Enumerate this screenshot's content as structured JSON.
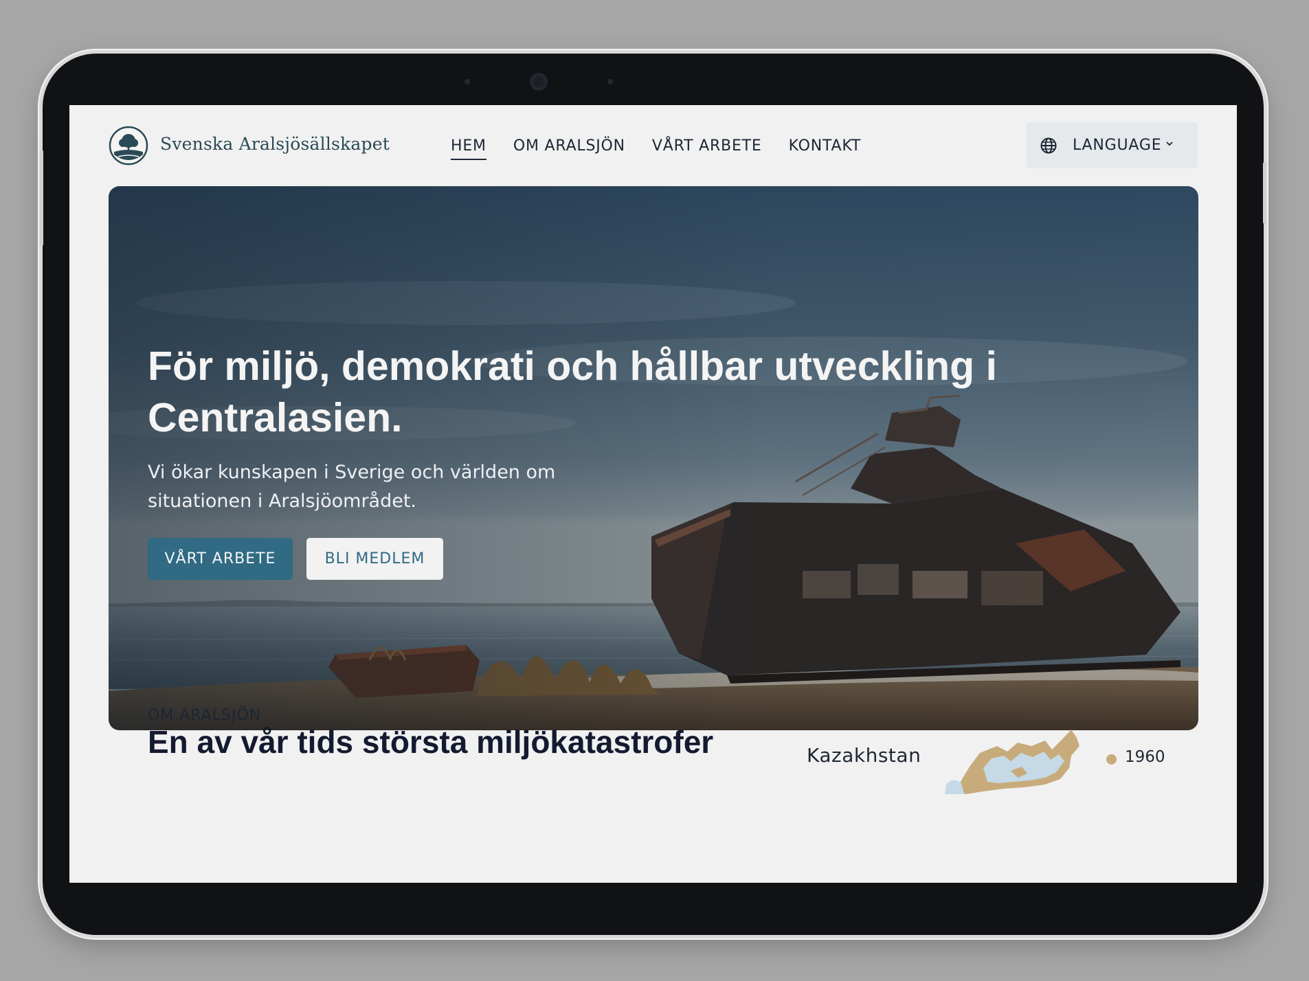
{
  "header": {
    "brand_name": "Svenska Aralsjösällskapet",
    "nav": [
      {
        "label": "HEM",
        "active": true
      },
      {
        "label": "OM ARALSJÖN",
        "active": false
      },
      {
        "label": "VÅRT ARBETE",
        "active": false
      },
      {
        "label": "KONTAKT",
        "active": false
      }
    ],
    "language_label": "LANGUAGE",
    "icons": {
      "language": "globe-icon",
      "dropdown": "chevron-down-icon",
      "logo": "tree-logo-icon"
    }
  },
  "hero": {
    "title": "För miljö, demokrati och hållbar utveckling i Centralasien.",
    "subtitle": "Vi ökar kunskapen i Sverige och världen om situationen i Aralsjöområdet.",
    "primary_button": "VÅRT ARBETE",
    "secondary_button": "BLI MEDLEM",
    "image": "shipwreck-on-beach-photo"
  },
  "about": {
    "eyebrow": "OM ARALSJÖN",
    "title": "En av vår tids största miljökatastrofer",
    "map_label": "Kazakhstan",
    "legend_year": "1960"
  },
  "colors": {
    "page_bg": "#f1f1f1",
    "primary": "#306a83",
    "text_dark": "#1c2533",
    "title_dark": "#141b30",
    "lang_bg": "#e5e9ec",
    "legend_1960": "#c8ab7a",
    "device_frame": "#111214"
  }
}
